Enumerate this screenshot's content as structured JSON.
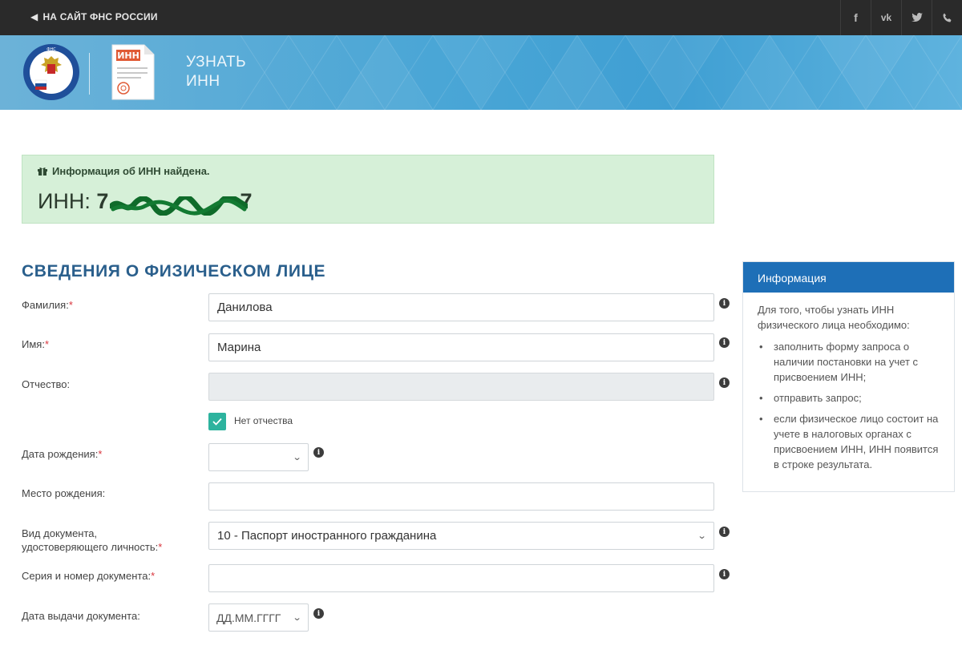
{
  "topbar": {
    "back_link": "НА САЙТ ФНС РОССИИ",
    "social": [
      {
        "icon": "facebook-icon",
        "glyph": "f"
      },
      {
        "icon": "vk-icon",
        "glyph": "vk"
      },
      {
        "icon": "twitter-icon",
        "glyph": "t"
      },
      {
        "icon": "phone-icon",
        "glyph": "☏"
      }
    ]
  },
  "banner": {
    "doc_icon_text": "ИНН",
    "title_line1": "УЗНАТЬ",
    "title_line2": "ИНН"
  },
  "alert": {
    "heading": "Информация об ИНН найдена.",
    "inn_label": "ИНН:",
    "inn_value_first": "7",
    "inn_value_last": "7"
  },
  "section_title": "СВЕДЕНИЯ О ФИЗИЧЕСКОМ ЛИЦЕ",
  "form": {
    "surname": {
      "label": "Фамилия:",
      "required": "*",
      "value": "Данилова"
    },
    "name": {
      "label": "Имя:",
      "required": "*",
      "value": "Марина"
    },
    "patronymic": {
      "label": "Отчество:",
      "value": ""
    },
    "no_patronymic": {
      "label": "Нет отчества",
      "checked": true
    },
    "birth_date": {
      "label": "Дата рождения:",
      "required": "*",
      "value": ""
    },
    "birth_place": {
      "label": "Место рождения:",
      "value": ""
    },
    "doc_type": {
      "label_line1": "Вид документа,",
      "label_line2": "удостоверяющего личность:",
      "required": "*",
      "value": "10 - Паспорт иностранного гражданина"
    },
    "doc_number": {
      "label": "Серия и номер документа:",
      "required": "*",
      "value": ""
    },
    "issue_date": {
      "label": "Дата выдачи документа:",
      "placeholder": "ДД.ММ.ГГГГ"
    }
  },
  "info_panel": {
    "title": "Информация",
    "intro": "Для того, чтобы узнать ИНН физического лица необходимо:",
    "items": [
      "заполнить форму запроса о наличии постановки на учет с присвоением ИНН;",
      "отправить запрос;",
      "если физическое лицо состоит на учете в налоговых органах с присвоением ИНН, ИНН появится в строке результата."
    ]
  },
  "colors": {
    "topbar_bg": "#2a2a2a",
    "banner_blue": "#4aa6d6",
    "alert_bg": "#d6f0d8",
    "section_title": "#2a5f8c",
    "panel_header": "#1e6fb7",
    "checkbox": "#2db39e",
    "required": "#d9363e"
  }
}
